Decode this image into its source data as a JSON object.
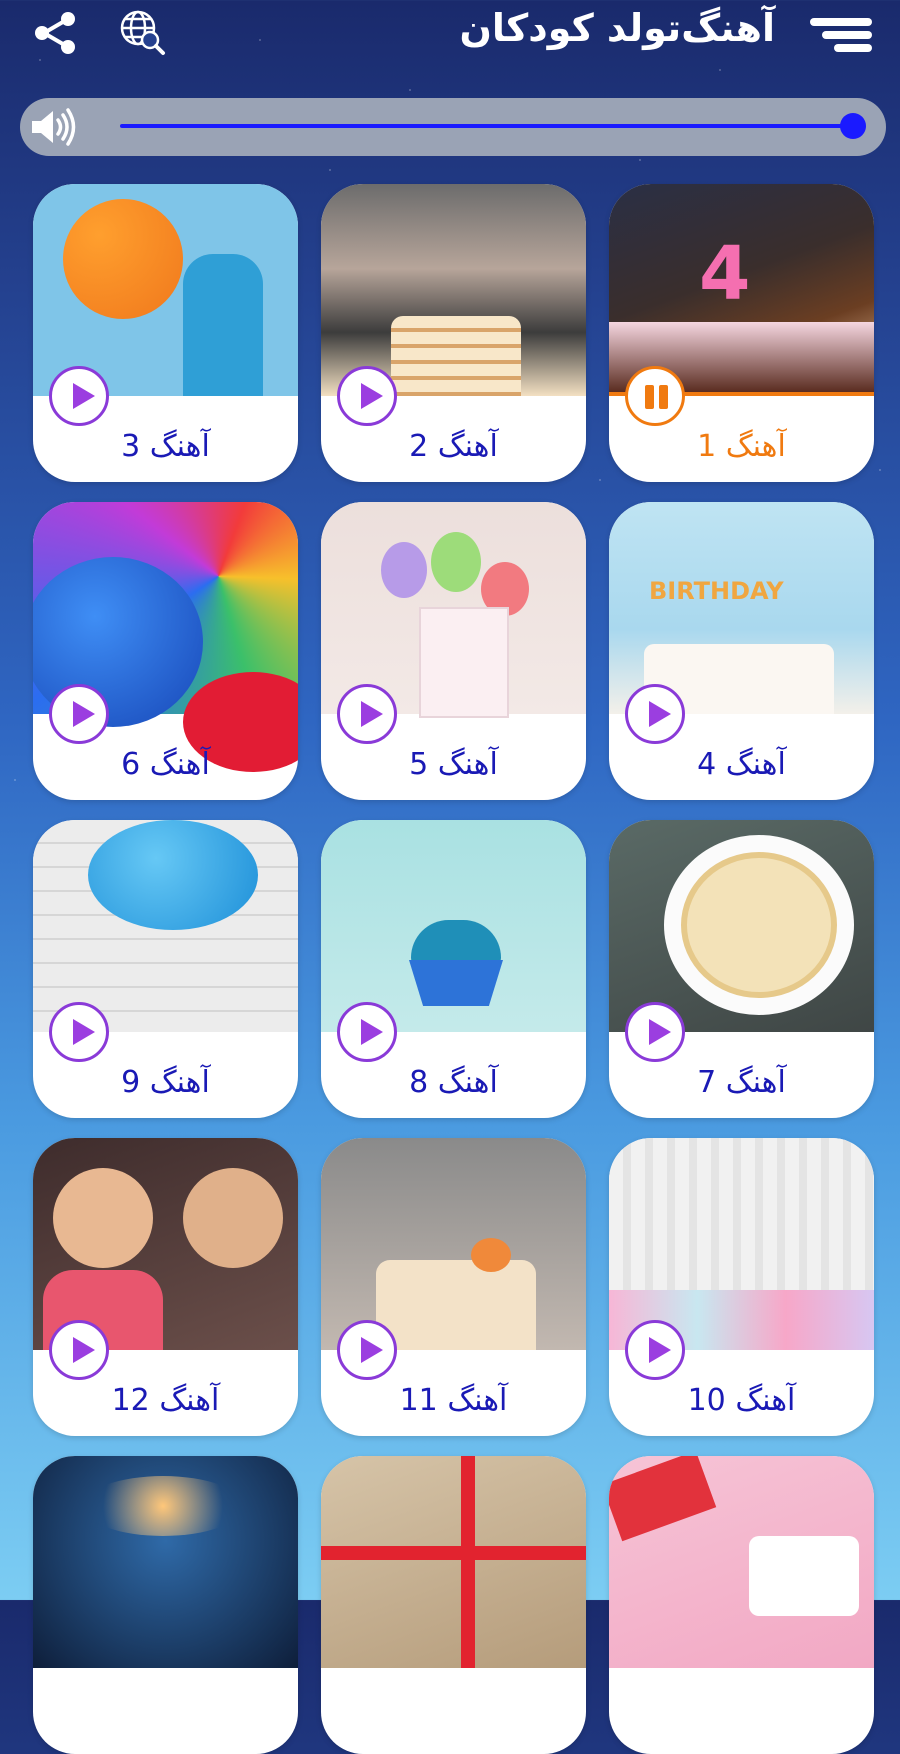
{
  "header": {
    "title": "آهنگ‌تولد کودکان",
    "menu_icon": "hamburger-icon",
    "globe_icon": "globe-search-icon",
    "share_icon": "share-icon"
  },
  "volume": {
    "level": 1.0,
    "icon": "speaker-icon",
    "color": "#1a1aff"
  },
  "colors": {
    "accent": "#f07a10",
    "label": "#1a1ab5",
    "play": "#9b3ee0"
  },
  "songs": [
    {
      "label": "آهنگ 1",
      "state": "playing"
    },
    {
      "label": "آهنگ 2",
      "state": "paused"
    },
    {
      "label": "آهنگ 3",
      "state": "paused"
    },
    {
      "label": "آهنگ 4",
      "state": "paused"
    },
    {
      "label": "آهنگ 5",
      "state": "paused"
    },
    {
      "label": "آهنگ 6",
      "state": "paused"
    },
    {
      "label": "آهنگ 7",
      "state": "paused"
    },
    {
      "label": "آهنگ 8",
      "state": "paused"
    },
    {
      "label": "آهنگ 9",
      "state": "paused"
    },
    {
      "label": "آهنگ 10",
      "state": "paused"
    },
    {
      "label": "آهنگ 11",
      "state": "paused"
    },
    {
      "label": "آهنگ 12",
      "state": "paused"
    }
  ]
}
